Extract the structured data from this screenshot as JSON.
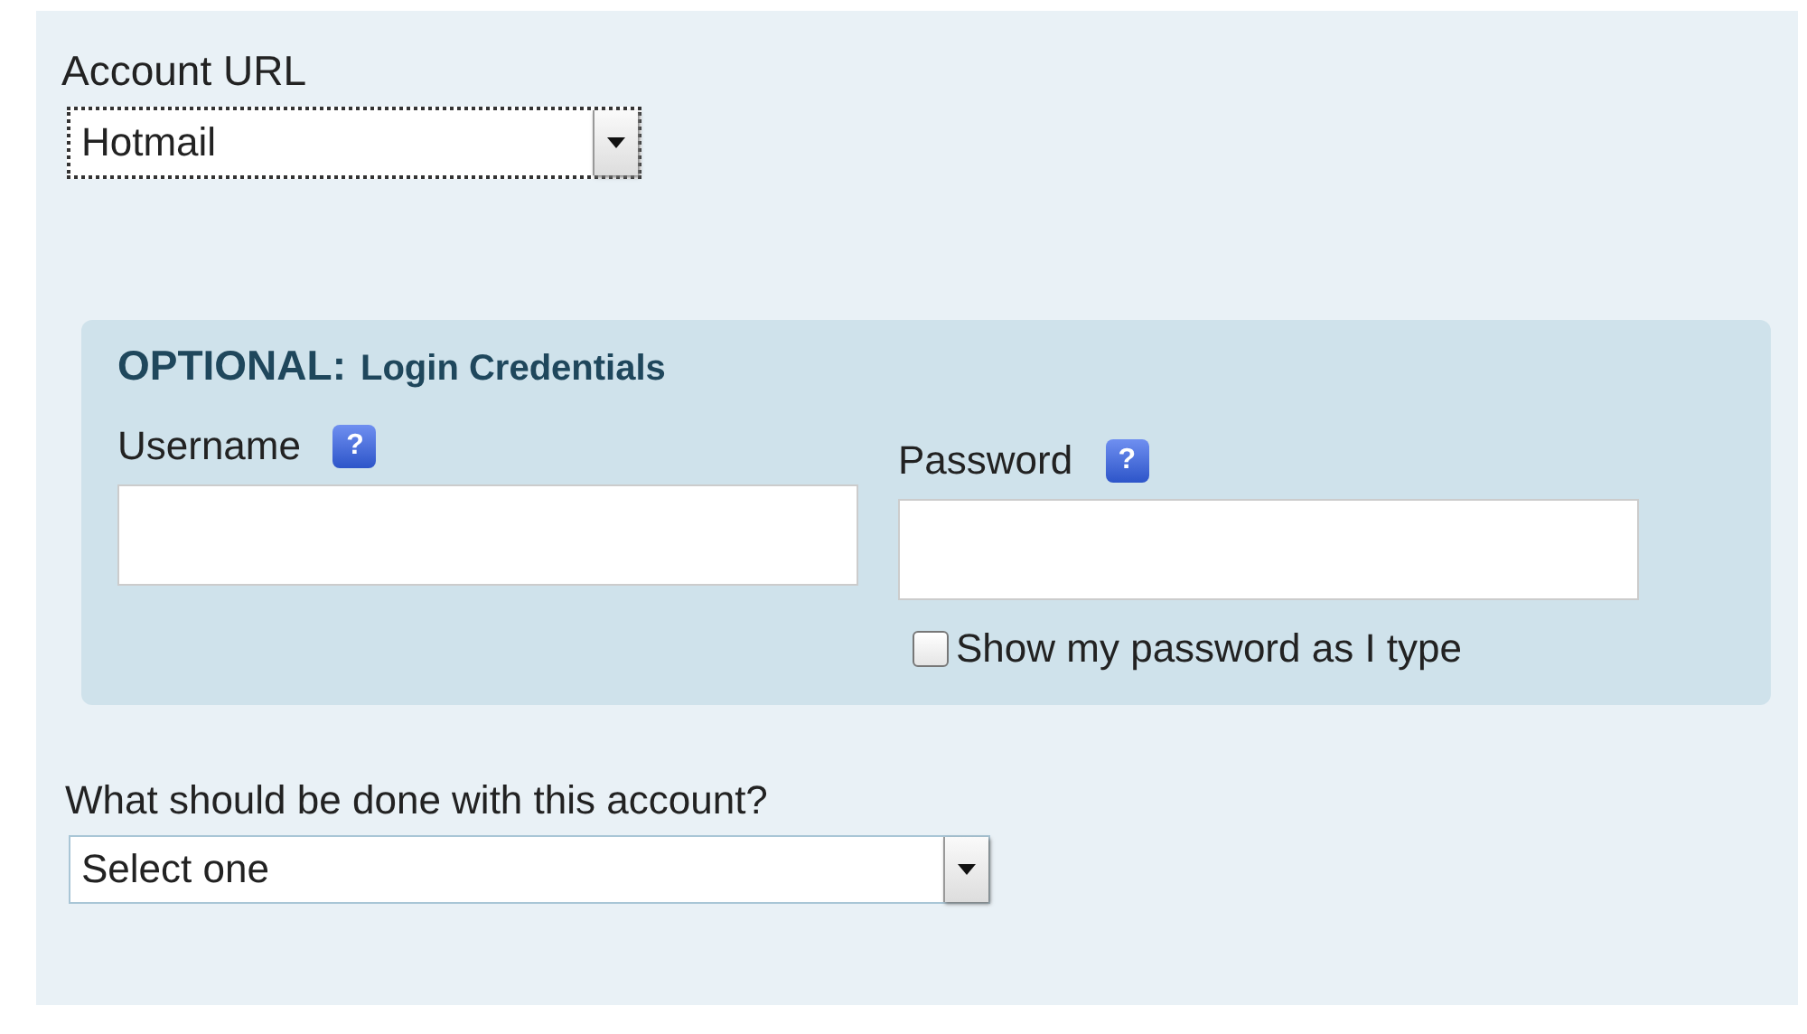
{
  "account_url": {
    "label": "Account URL",
    "value": "Hotmail"
  },
  "credentials": {
    "tag": "OPTIONAL:",
    "title": "Login Credentials",
    "fields": [
      {
        "label": "Username",
        "help": "?"
      },
      {
        "label": "Password",
        "help": "?"
      }
    ],
    "show_password": {
      "label": "Show my password as I type",
      "checked": false
    }
  },
  "action": {
    "label": "What should be done with this account?",
    "value": "Select one"
  }
}
